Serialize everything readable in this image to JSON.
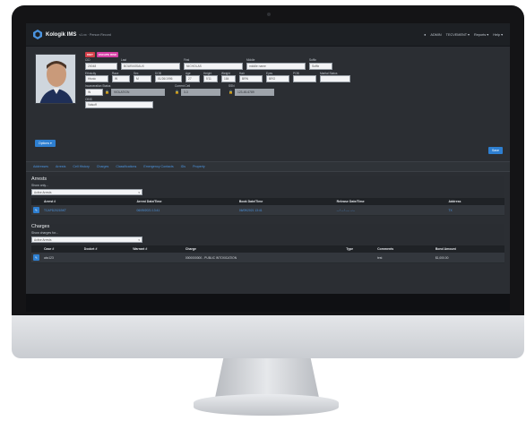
{
  "app": {
    "brand": "Kologik IMS",
    "brand_sub": "v1.xx · Person Record",
    "nav": [
      "ADMIN",
      "TECVEMENT ▾",
      "Reports ▾",
      "Help ▾"
    ]
  },
  "badges": [
    "DIET",
    "ESCAPE RISK"
  ],
  "person": {
    "labels": {
      "cid": "CID",
      "last": "Last",
      "first": "First",
      "middle": "Middle",
      "suffix": "Suffix",
      "ethnicity": "Ethnicity",
      "race": "Race",
      "sex": "Sex",
      "dob": "DOB",
      "age": "Age",
      "height": "Height",
      "weight": "Weight",
      "hair": "Hair",
      "eyes": "Eyes",
      "pob": "POB",
      "marital": "Marital Status",
      "incarceration": "Incarceration Status",
      "current_cell": "Current Cell",
      "ssn": "SSN",
      "oins": "OINS"
    },
    "values": {
      "cid": "20048",
      "last": "BOURASSAUX",
      "first": "NICHOLAS",
      "middle": "middle name",
      "suffix": "Suffix",
      "ethnicity": "Hisnic",
      "race": "W",
      "sex": "M",
      "dob": "01/26/1996",
      "age": "27",
      "height": "5'11",
      "weight": "184",
      "hair": "BRN",
      "eyes": "BRO",
      "pob": "",
      "marital": "",
      "incarceration": "IN",
      "incarceration_detail": "VIOLATION",
      "current_cell": "3-3",
      "ssn": "123-45-6789",
      "oins": "Valsoff"
    },
    "options_label": "Options ▾",
    "save_label": "Save"
  },
  "tabs": [
    "Addresses",
    "Arrests",
    "Cell History",
    "Charges",
    "Classifications",
    "Emergency Contacts",
    "IDs",
    "Property"
  ],
  "arrests": {
    "title": "Arrests",
    "show_label": "Show only...",
    "select_value": "Active Arrests",
    "columns": [
      "Arrest #",
      "Arrest Date/Time",
      "Book Date/Time",
      "Release Date/Time",
      "Address"
    ],
    "rows": [
      [
        "TCAPD2021BKT",
        "06/09/2021 13:41",
        "06/09/2021 13:41",
        "-- / -- / ---- --:--",
        "TX"
      ]
    ]
  },
  "charges": {
    "title": "Charges",
    "show_label": "Show charges for...",
    "select_value": "Active Arrests",
    "columns": [
      "Case #",
      "Docket #",
      "Warrant #",
      "Charge",
      "Type",
      "Comments",
      "Bond Amount"
    ],
    "rows": [
      [
        "abc123",
        "",
        "",
        "0000000000 - PUBLIC INTOXICATION",
        "",
        "test",
        "$1,000.00"
      ]
    ]
  },
  "colors": {
    "accent": "#2e7fd1",
    "tab_link": "#4b94e0",
    "screen_bg": "#2b2e33"
  }
}
